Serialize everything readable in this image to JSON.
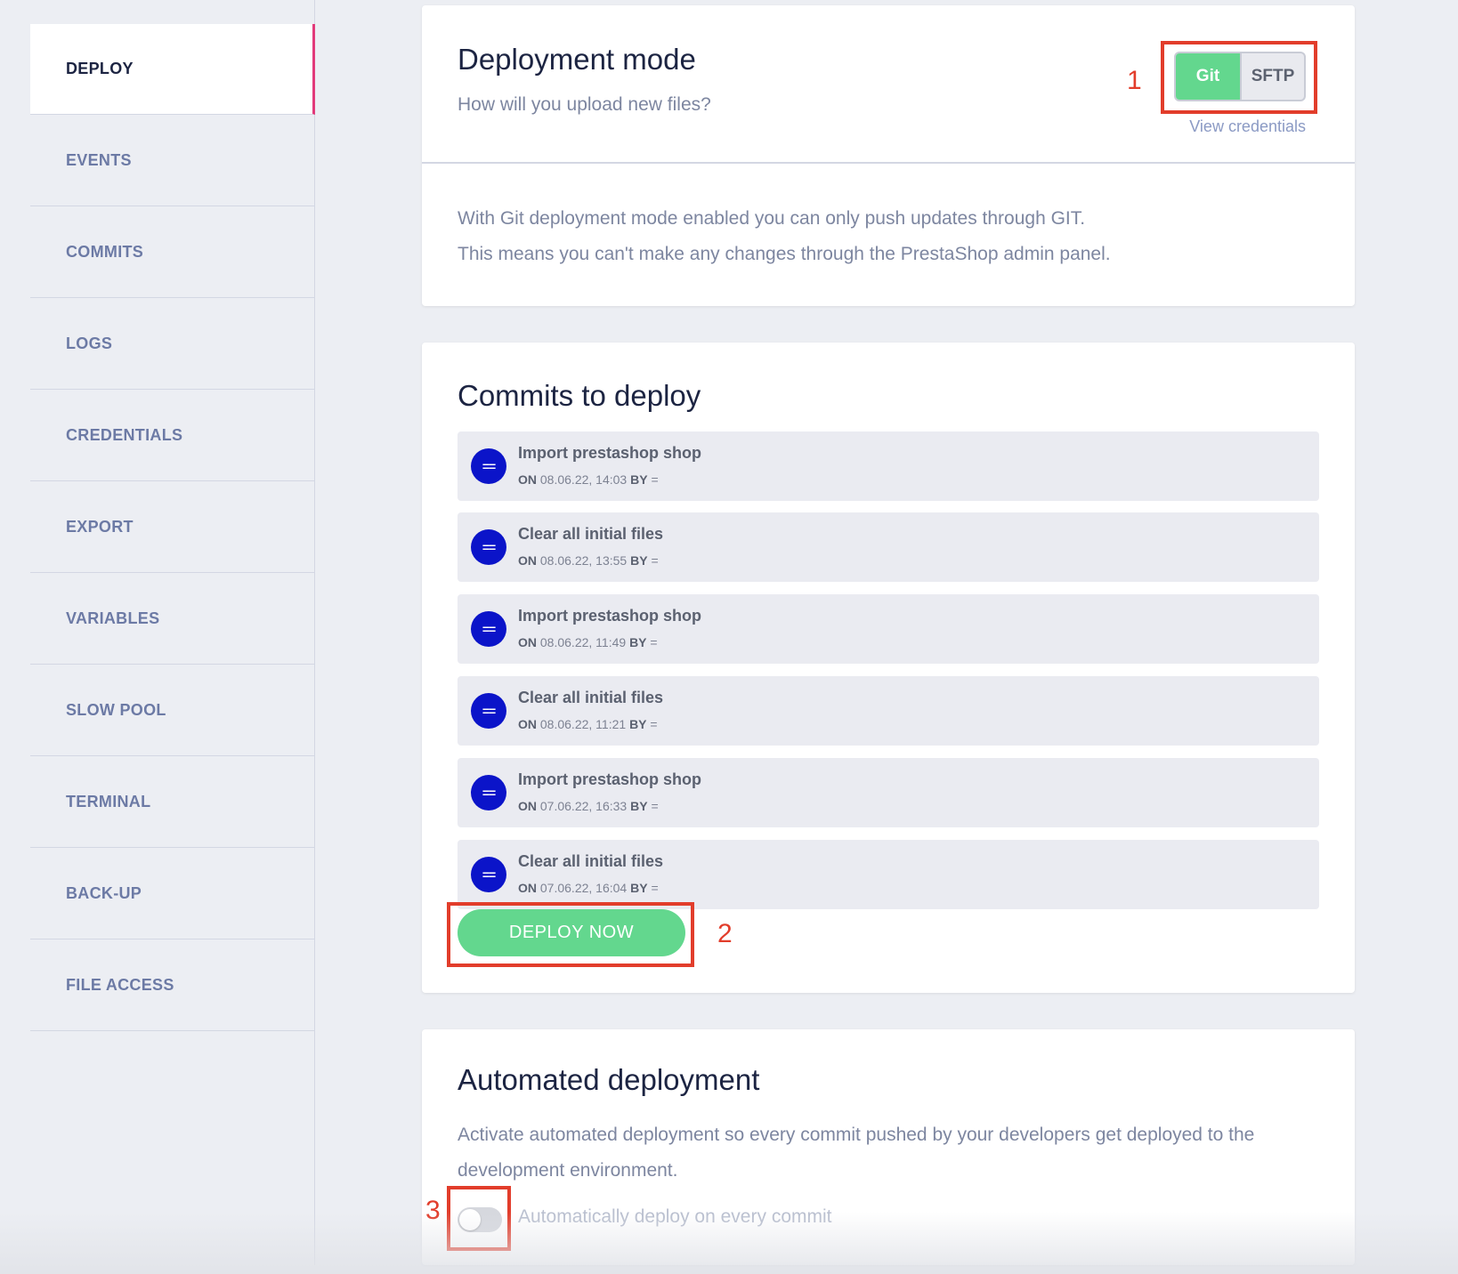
{
  "sidebar": {
    "items": [
      {
        "label": "DEPLOY",
        "active": true
      },
      {
        "label": "EVENTS"
      },
      {
        "label": "COMMITS"
      },
      {
        "label": "LOGS"
      },
      {
        "label": "CREDENTIALS"
      },
      {
        "label": "EXPORT"
      },
      {
        "label": "VARIABLES"
      },
      {
        "label": "SLOW POOL"
      },
      {
        "label": "TERMINAL"
      },
      {
        "label": "BACK-UP"
      },
      {
        "label": "FILE ACCESS"
      }
    ]
  },
  "deployment_mode": {
    "title": "Deployment mode",
    "subtitle": "How will you upload new files?",
    "options": {
      "git": "Git",
      "sftp": "SFTP"
    },
    "selected": "Git",
    "view_credentials": "View credentials",
    "description_line1": "With Git deployment mode enabled you can only push updates through GIT.",
    "description_line2": "This means you can't make any changes through the PrestaShop admin panel."
  },
  "commits": {
    "title": "Commits to deploy",
    "on_label": "ON",
    "by_label": "BY",
    "items": [
      {
        "avatar": "==",
        "message": "Import prestashop shop",
        "date": "08.06.22, 14:03",
        "author": "="
      },
      {
        "avatar": "==",
        "message": "Clear all initial files",
        "date": "08.06.22, 13:55",
        "author": "="
      },
      {
        "avatar": "==",
        "message": "Import prestashop shop",
        "date": "08.06.22, 11:49",
        "author": "="
      },
      {
        "avatar": "==",
        "message": "Clear all initial files",
        "date": "08.06.22, 11:21",
        "author": "="
      },
      {
        "avatar": "==",
        "message": "Import prestashop shop",
        "date": "07.06.22, 16:33",
        "author": "="
      },
      {
        "avatar": "==",
        "message": "Clear all initial files",
        "date": "07.06.22, 16:04",
        "author": "="
      }
    ],
    "deploy_button": "DEPLOY NOW"
  },
  "automated": {
    "title": "Automated deployment",
    "description": "Activate automated deployment so every commit pushed by your developers get deployed to the development environment.",
    "toggle_label": "Automatically deploy on every commit",
    "enabled": false
  },
  "annotations": {
    "one": "1",
    "two": "2",
    "three": "3"
  },
  "colors": {
    "accent_green": "#63d78e",
    "avatar_blue": "#0b14c9",
    "active_border": "#e23a7a",
    "annotation_red": "#e23d2b"
  }
}
